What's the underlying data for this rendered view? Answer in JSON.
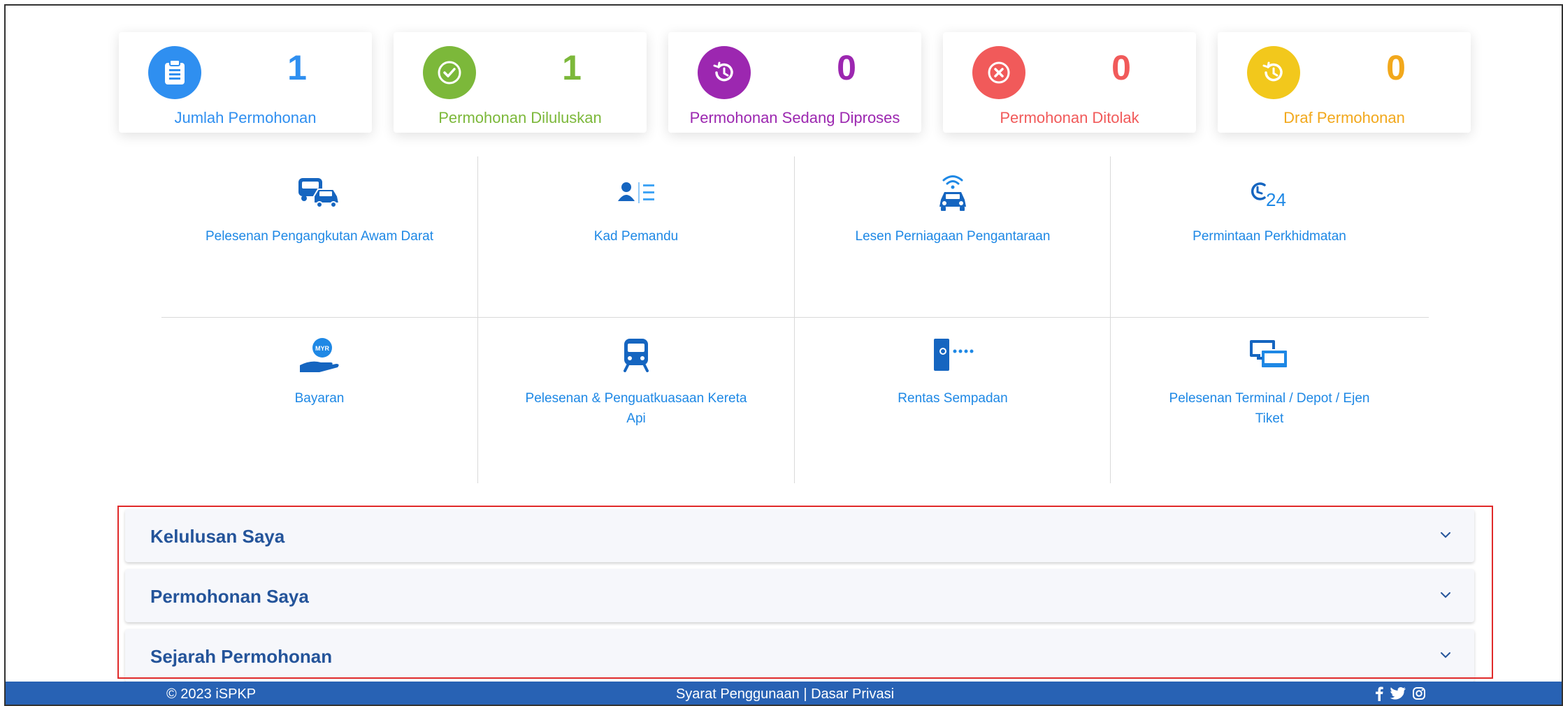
{
  "stats": [
    {
      "value": "1",
      "label": "Jumlah Permohonan",
      "color": "#2f8ff0",
      "icon": "clipboard-icon"
    },
    {
      "value": "1",
      "label": "Permohonan Diluluskan",
      "color": "#7cb83a",
      "icon": "check-circle-icon"
    },
    {
      "value": "0",
      "label": "Permohonan Sedang Diproses",
      "color": "#9c27b0",
      "icon": "history-icon"
    },
    {
      "value": "0",
      "label": "Permohonan Ditolak",
      "color": "#f15a5a",
      "icon": "close-circle-icon"
    },
    {
      "value": "0",
      "label": "Draf Permohonan",
      "color": "#f2a81c",
      "icon": "history-icon"
    }
  ],
  "services": [
    {
      "label": "Pelesenan Pengangkutan Awam Darat",
      "icon": "bus-car-icon"
    },
    {
      "label": "Kad Pemandu",
      "icon": "driver-card-icon"
    },
    {
      "label": "Lesen Perniagaan Pengantaraan",
      "icon": "connected-car-icon"
    },
    {
      "label": "Permintaan Perkhidmatan",
      "icon": "service-24-icon"
    },
    {
      "label": "Bayaran",
      "icon": "payment-hand-icon"
    },
    {
      "label": "Pelesenan & Penguatkuasaan Kereta Api",
      "icon": "train-icon"
    },
    {
      "label": "Rentas Sempadan",
      "icon": "border-gate-icon"
    },
    {
      "label": "Pelesenan Terminal / Depot / Ejen Tiket",
      "icon": "terminal-icon"
    }
  ],
  "icon_text": {
    "myr": "MYR",
    "twentyfour": "24"
  },
  "accordion": [
    {
      "title": "Kelulusan Saya"
    },
    {
      "title": "Permohonan Saya"
    },
    {
      "title": "Sejarah Permohonan"
    }
  ],
  "footer": {
    "copyright": "© 2023 iSPKP",
    "terms": "Syarat Penggunaan",
    "separator": "|",
    "privacy": "Dasar Privasi"
  },
  "colors": {
    "accent": "#1e88e5",
    "footer": "#2862b4",
    "accordion_title": "#24549a",
    "highlight": "#e02a2a"
  }
}
